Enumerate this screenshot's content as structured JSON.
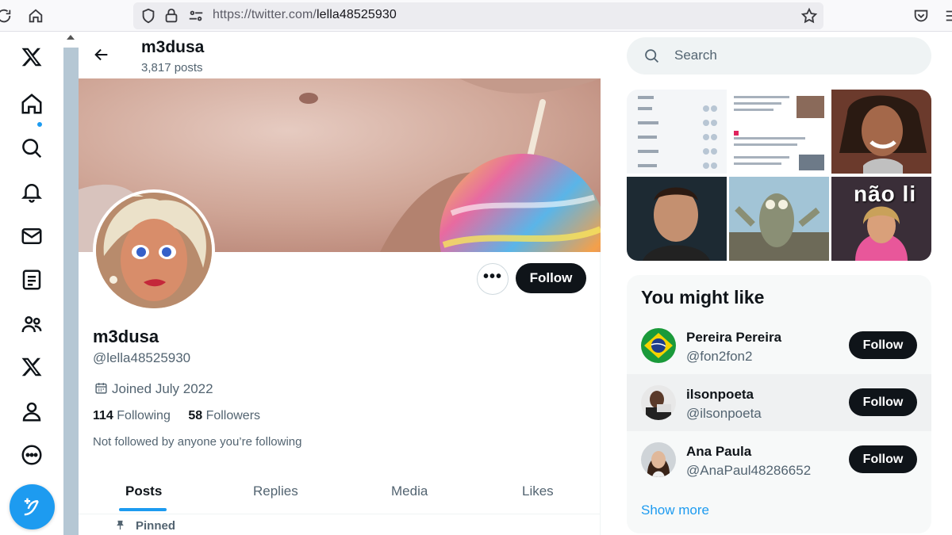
{
  "browser": {
    "url_prefix": "https://twitter.com/",
    "url_path": "lella48525930",
    "icons": [
      "reload-icon",
      "home-icon",
      "shield-icon",
      "lock-icon",
      "permissions-icon",
      "star-icon",
      "pocket-icon",
      "menu-icon"
    ]
  },
  "nav": {
    "items": [
      "x-logo",
      "home-icon",
      "explore-icon",
      "notifications-icon",
      "messages-icon",
      "lists-icon",
      "communities-icon",
      "premium-icon",
      "profile-icon",
      "more-icon"
    ],
    "compose": "compose-icon"
  },
  "header": {
    "name": "m3dusa",
    "post_count": "3,817 posts"
  },
  "profile": {
    "name": "m3dusa",
    "handle": "@lella48525930",
    "joined": "Joined July 2022",
    "following_count": "114",
    "following_label": "Following",
    "followers_count": "58",
    "followers_label": "Followers",
    "not_followed": "Not followed by anyone you’re following",
    "more_label": "•••",
    "follow_label": "Follow"
  },
  "tabs": [
    "Posts",
    "Replies",
    "Media",
    "Likes"
  ],
  "pinned_label": "Pinned",
  "search": {
    "placeholder": "Search"
  },
  "media": {
    "tile_text": "não li"
  },
  "who_to_follow": {
    "title": "You might like",
    "users": [
      {
        "name": "Pereira Pereira",
        "handle": "@fon2fon2",
        "button": "Follow"
      },
      {
        "name": "ilsonpoeta",
        "handle": "@ilsonpoeta",
        "button": "Follow"
      },
      {
        "name": "Ana Paula",
        "handle": "@AnaPaul48286652",
        "button": "Follow"
      }
    ],
    "show_more": "Show more"
  },
  "colors": {
    "accent": "#1d9bf0",
    "text": "#0f1419",
    "secondary": "#536471"
  }
}
